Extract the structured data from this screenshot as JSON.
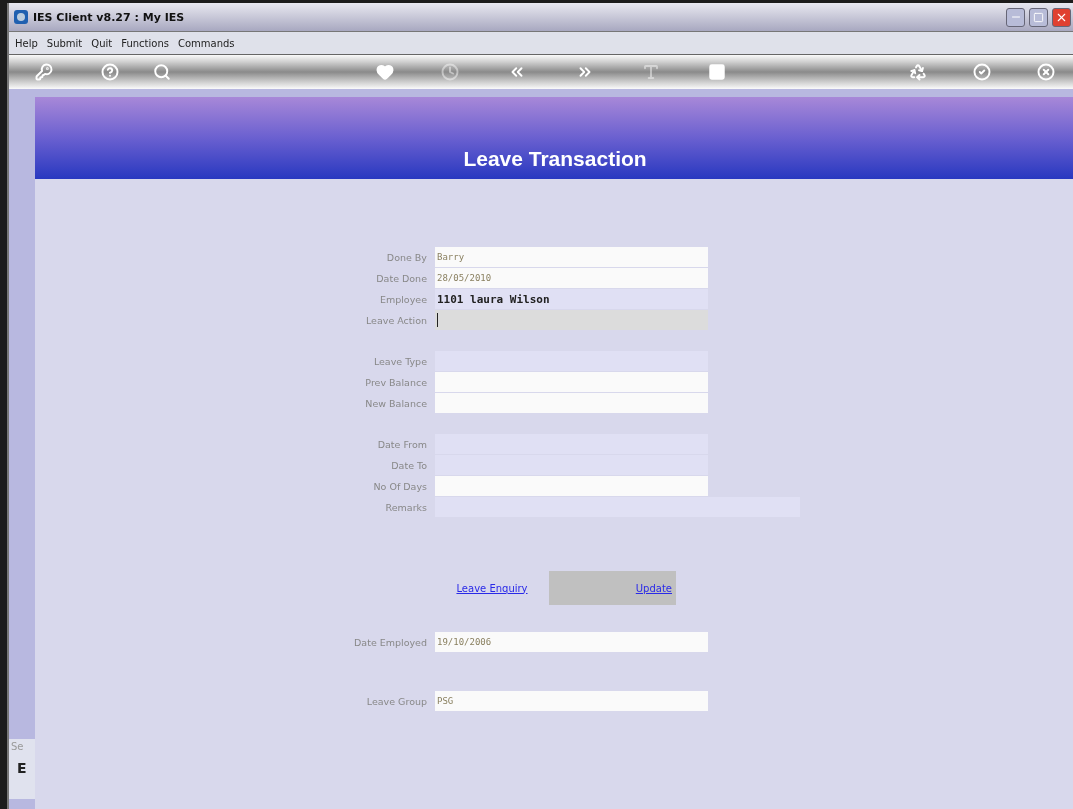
{
  "window": {
    "title": "IES Client v8.27 : My IES"
  },
  "menu": [
    "Help",
    "Submit",
    "Quit",
    "Functions",
    "Commands"
  ],
  "toolbar": [
    {
      "kind": "key",
      "disabled": false
    },
    {
      "kind": "help",
      "disabled": false
    },
    {
      "kind": "search",
      "disabled": false
    },
    {
      "kind": "heart",
      "disabled": false
    },
    {
      "kind": "clock",
      "disabled": true
    },
    {
      "kind": "back",
      "disabled": false
    },
    {
      "kind": "forward",
      "disabled": false
    },
    {
      "kind": "text",
      "disabled": true
    },
    {
      "kind": "stop",
      "disabled": false
    },
    {
      "kind": "recycle",
      "disabled": false
    },
    {
      "kind": "ok",
      "disabled": false
    },
    {
      "kind": "cancel",
      "disabled": false
    }
  ],
  "header": {
    "title": "Leave Transaction"
  },
  "sections": [
    {
      "kind": "fields",
      "fields": [
        {
          "label": "Done By",
          "value": "Barry",
          "kind": "editable",
          "wide": false
        },
        {
          "label": "Date Done",
          "value": "28/05/2010",
          "kind": "editable",
          "wide": false
        },
        {
          "label": "Employee",
          "value": "1101 laura Wilson",
          "kind": "readonly",
          "wide": false
        },
        {
          "label": "Leave Action",
          "kind": "focused",
          "wide": false
        }
      ]
    },
    {
      "kind": "fields",
      "fields": [
        {
          "label": "Leave Type",
          "kind": "readonly",
          "wide": false
        },
        {
          "label": "Prev Balance",
          "kind": "editable",
          "wide": false
        },
        {
          "label": "New Balance",
          "kind": "editable",
          "wide": false
        }
      ]
    },
    {
      "kind": "fields",
      "fields": [
        {
          "label": "Date From",
          "kind": "readonly",
          "wide": false
        },
        {
          "label": "Date To",
          "kind": "readonly",
          "wide": false
        },
        {
          "label": "No Of Days",
          "kind": "editable",
          "wide": false
        },
        {
          "label": "Remarks",
          "kind": "readonly",
          "wide": true
        }
      ]
    },
    {
      "kind": "actions",
      "actions": [
        {
          "kind": "link",
          "label": "Leave Enquiry"
        },
        {
          "kind": "button",
          "label": "Update"
        }
      ]
    },
    {
      "kind": "fields",
      "fields": [
        {
          "label": "Date Employed",
          "value": "19/10/2006",
          "kind": "editable",
          "wide": false
        }
      ]
    },
    {
      "kind": "fields",
      "fields": [
        {
          "label": "Leave Group",
          "value": "PSG",
          "kind": "editable",
          "wide": false
        }
      ]
    }
  ],
  "side_panel": {
    "texts": [
      "Se",
      "E"
    ]
  }
}
